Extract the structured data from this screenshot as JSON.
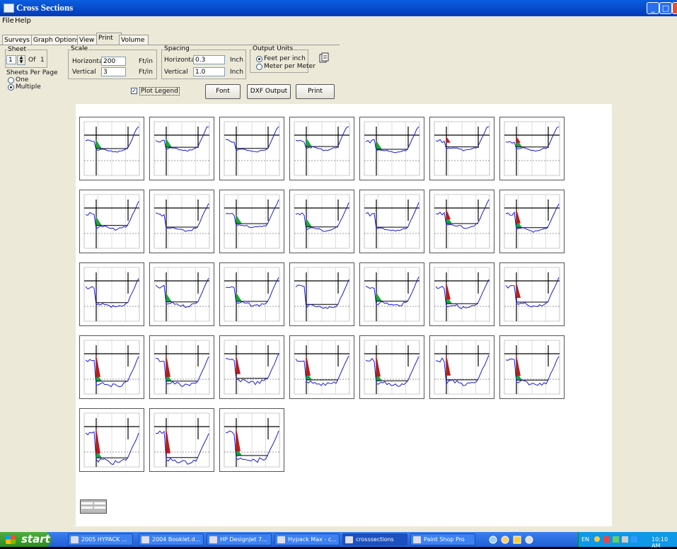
{
  "window": {
    "title": "Cross Sections"
  },
  "menu": [
    "File",
    "Help"
  ],
  "tabs": [
    "Surveys",
    "Graph Options",
    "View",
    "Print",
    "Volume"
  ],
  "active_tab": "Print",
  "sheet": {
    "label": "Sheet",
    "value": "1",
    "of_label": "Of",
    "total": "1"
  },
  "sheets_per_page": {
    "label": "Sheets Per Page",
    "options": [
      "One",
      "Multiple"
    ],
    "selected": "Multiple"
  },
  "scale": {
    "label": "Scale",
    "horizontal_label": "Horizontal",
    "horizontal_value": "200",
    "vertical_label": "Vertical",
    "vertical_value": "3",
    "unit": "Ft/in"
  },
  "spacing": {
    "label": "Spacing",
    "horizontal_label": "Horizontal",
    "horizontal_value": "0.3",
    "vertical_label": "Vertical",
    "vertical_value": "1.0",
    "unit": "Inch"
  },
  "output_units": {
    "label": "Output Units",
    "options": [
      "Feet per inch",
      "Meter per Meter"
    ],
    "selected": "Feet per inch"
  },
  "plot_legend": {
    "label": "Plot Legend",
    "checked": true
  },
  "buttons": {
    "font": "Font",
    "dxf": "DXF Output",
    "print": "Print"
  },
  "cross_section_count": 31,
  "colors": {
    "profile": "#1a1adb",
    "fill_green": "#1aa83a",
    "fill_red": "#c01a1a",
    "frame": "#000000"
  },
  "taskbar": {
    "start": "start",
    "items": [
      "2005 HYPACK ...",
      "2004 Booklet.d...",
      "HP DesignJet 7...",
      "Hypack Max - c...",
      "crosssections",
      "Paint Shop Pro"
    ],
    "active": "crosssections",
    "language": "EN",
    "clock": "10:10 AM"
  }
}
